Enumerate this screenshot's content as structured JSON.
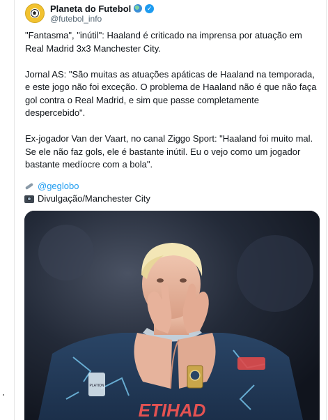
{
  "tweet": {
    "account_name": "Planeta do Futebol",
    "handle": "@futebol_info",
    "paragraphs": [
      "\"Fantasma\", \"inútil\": Haaland é criticado na imprensa por atuação em Real Madrid 3x3 Manchester City.",
      "Jornal AS: \"São muitas as atuações apáticas de Haaland na temporada, e este jogo não foi exceção. O problema de Haaland não é que não faça gol contra o Real Madrid, e sim que passe completamente despercebido\".",
      "Ex-jogador Van der Vaart, no canal Ziggo Sport: \"Haaland foi muito mal. Se ele não faz gols, ele é bastante inútil. Eu o vejo como um jogador bastante medíocre com a bola\"."
    ],
    "source_link": "@geglobo",
    "photo_credit": "Divulgação/Manchester City"
  },
  "media": {
    "shirt_sponsor": "ETIHAD",
    "sleeve_badge": "PLATION",
    "subject": "Player in dark Manchester City away kit applauding"
  },
  "colors": {
    "link": "#1d9bf0",
    "verified": "#1d9bf0",
    "shirt": "#233a58",
    "shirt_accent": "#79c9f0"
  },
  "icons": [
    "globe-icon",
    "verified-badge-icon",
    "link-icon",
    "camera-icon"
  ]
}
